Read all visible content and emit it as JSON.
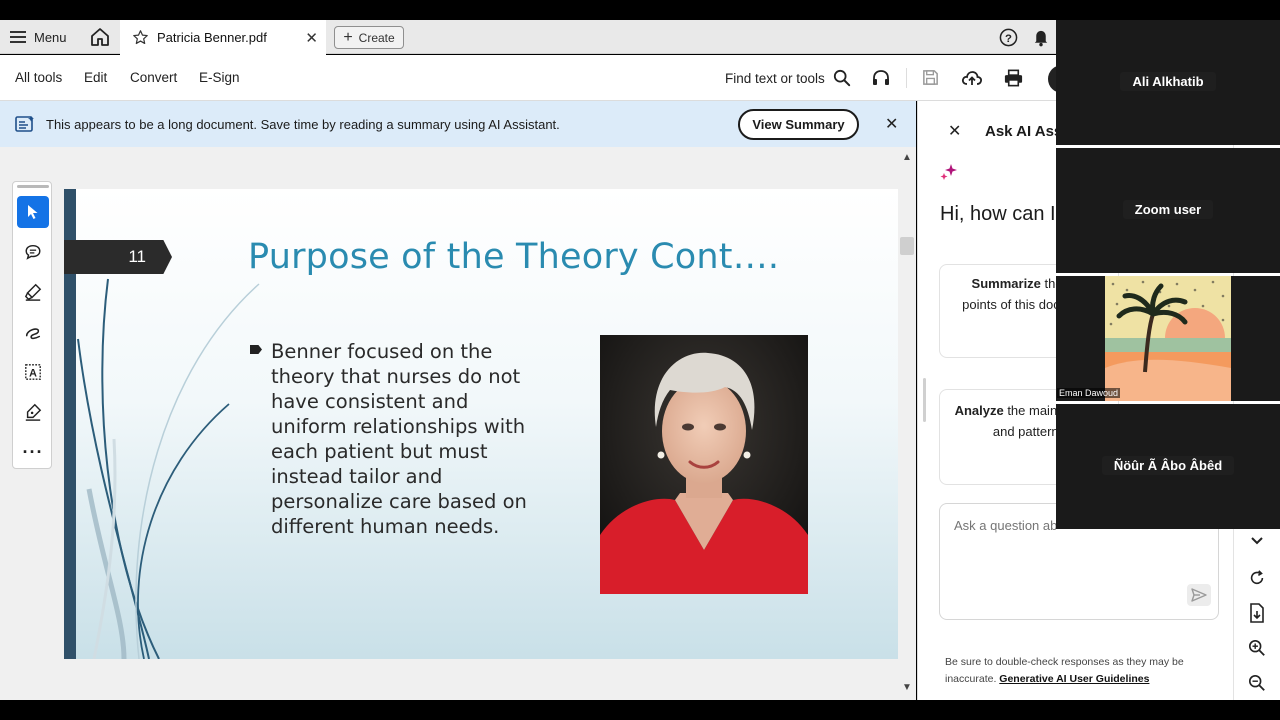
{
  "tabbar": {
    "menu_label": "Menu",
    "tab_title": "Patricia Benner.pdf",
    "create_label": "Create"
  },
  "toolbar": {
    "all_tools": "All tools",
    "edit": "Edit",
    "convert": "Convert",
    "esign": "E-Sign",
    "find": "Find text or tools"
  },
  "banner": {
    "text": "This appears to be a long document. Save time by reading a summary using AI Assistant.",
    "button": "View Summary"
  },
  "slide": {
    "number": "11",
    "title": "Purpose of the Theory Cont….",
    "body": "Benner focused on the theory that nurses do not have consistent and uniform relationships with each patient but must instead tailor and personalize care based on different human needs."
  },
  "ai_panel": {
    "title": "Ask AI Assi",
    "greeting": "Hi, how can I",
    "card1_bold": "Summarize",
    "card1_rest": " the key points of this document",
    "card2_bold": "Analyze",
    "card2_rest": " the main themes and patterns",
    "input_placeholder": "Ask a question ab",
    "disclaimer": "Be sure to double-check responses as they may be inaccurate. ",
    "disclaimer_link": "Generative AI User Guidelines"
  },
  "zoom": {
    "tile1_name": "Ali Alkhatib",
    "tile2_name": "Zoom user",
    "tile3_label": "Eman Dawoud",
    "tile4_name": "Ñöûr Ã Âbo Âbêd"
  },
  "colors": {
    "accent_blue": "#1473e6",
    "slide_title": "#2a8bb0",
    "banner_bg": "#dcebf9",
    "photo_red": "#d81e2a"
  }
}
